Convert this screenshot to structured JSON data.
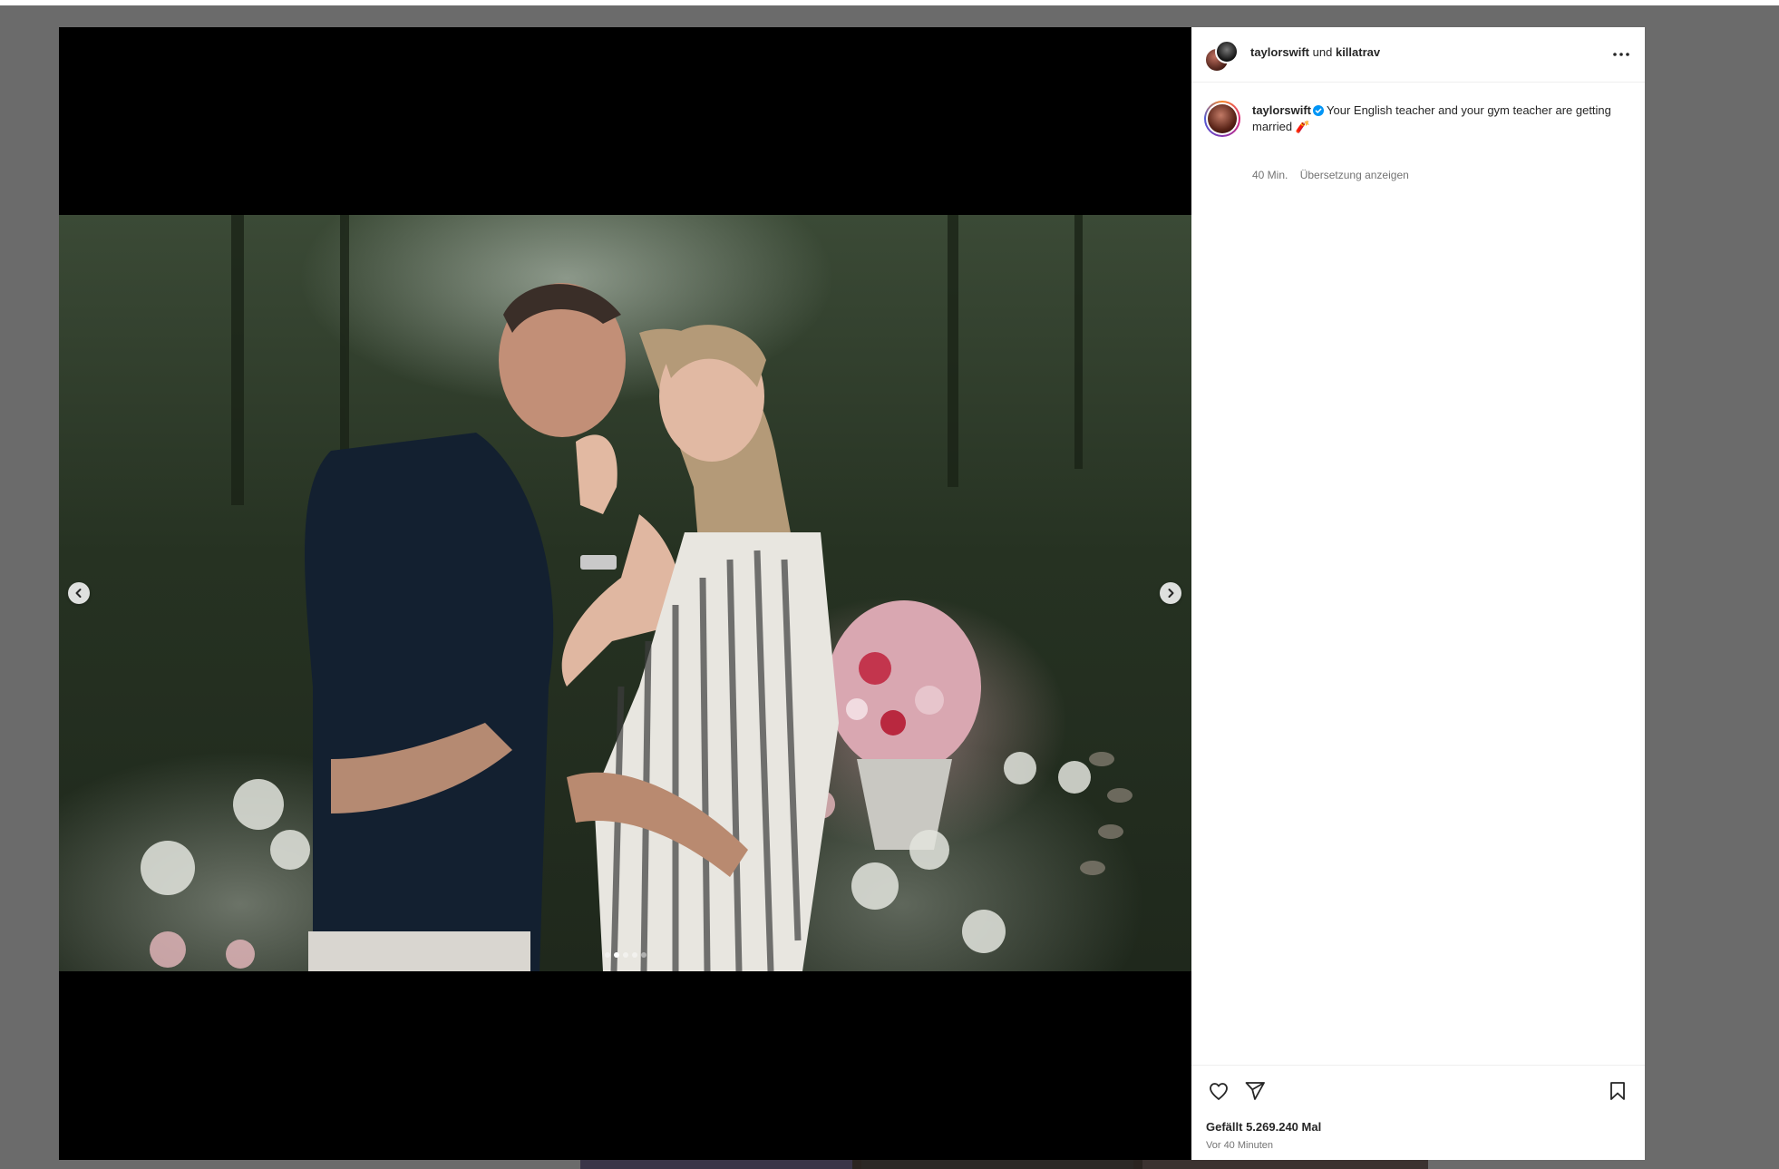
{
  "post": {
    "header": {
      "owner": "taylorswift",
      "connector": "und",
      "collaborator": "killatrav",
      "more_icon": "more-horizontal-icon"
    },
    "caption": {
      "username": "taylorswift",
      "text": "Your English teacher and your gym teacher are getting married",
      "emoji": "🧨",
      "time": "40 Min.",
      "translate_label": "Übersetzung anzeigen"
    },
    "actions": {
      "like_icon": "heart-icon",
      "share_icon": "send-icon",
      "save_icon": "bookmark-icon"
    },
    "likes_label": "Gefällt 5.269.240 Mal",
    "time_ago": "Vor 40 Minuten"
  },
  "media": {
    "prev_icon": "chevron-left-icon",
    "next_icon": "chevron-right-icon",
    "slide_count": 5,
    "active_slide": 2
  },
  "colors": {
    "backdrop": "#6b6b6b",
    "verified_blue": "#0095f6",
    "text_primary": "#262626",
    "text_secondary": "#737373"
  }
}
